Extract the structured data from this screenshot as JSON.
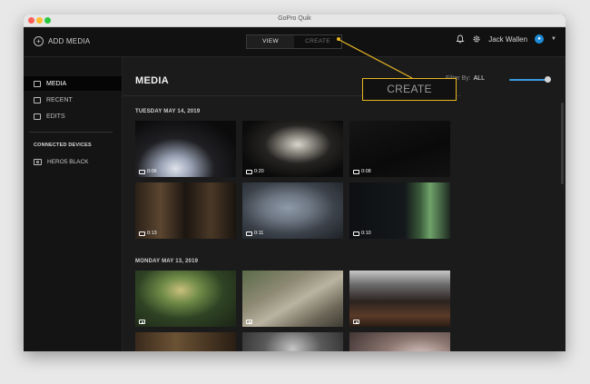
{
  "window": {
    "title": "GoPro Quik"
  },
  "topbar": {
    "add_media_label": "ADD MEDIA",
    "tabs": [
      {
        "label": "VIEW",
        "active": true
      },
      {
        "label": "CREATE",
        "active": false
      }
    ],
    "user_name": "Jack Wallen",
    "icons": [
      "bell-icon",
      "gear-icon",
      "avatar-icon",
      "chevron-down-icon"
    ]
  },
  "sidebar": {
    "items": [
      {
        "label": "MEDIA",
        "icon": "media-icon",
        "active": true
      },
      {
        "label": "RECENT",
        "icon": "recent-icon",
        "active": false
      },
      {
        "label": "EDITS",
        "icon": "edits-icon",
        "active": false
      }
    ],
    "connected_title": "CONNECTED DEVICES",
    "devices": [
      {
        "label": "HERO5 BLACK",
        "icon": "camera-icon"
      }
    ]
  },
  "main": {
    "title": "MEDIA",
    "filter_label": "Filter By:",
    "filter_value": "ALL",
    "groups": [
      {
        "date": "TUESDAY MAY 14, 2019",
        "items": [
          {
            "type": "video",
            "duration": "0:06"
          },
          {
            "type": "video",
            "duration": "0:20"
          },
          {
            "type": "video",
            "duration": "0:08"
          },
          {
            "type": "video",
            "duration": "0:13"
          },
          {
            "type": "video",
            "duration": "0:11"
          },
          {
            "type": "video",
            "duration": "0:10"
          }
        ]
      },
      {
        "date": "MONDAY MAY 13, 2019",
        "items": [
          {
            "type": "photo"
          },
          {
            "type": "photo"
          },
          {
            "type": "photo"
          },
          {
            "type": "photo"
          },
          {
            "type": "photo"
          },
          {
            "type": "photo"
          }
        ]
      }
    ]
  },
  "callout": {
    "label": "CREATE",
    "color": "#e8b623"
  },
  "colors": {
    "accent": "#1e8bd6",
    "highlight": "#e8b623"
  }
}
